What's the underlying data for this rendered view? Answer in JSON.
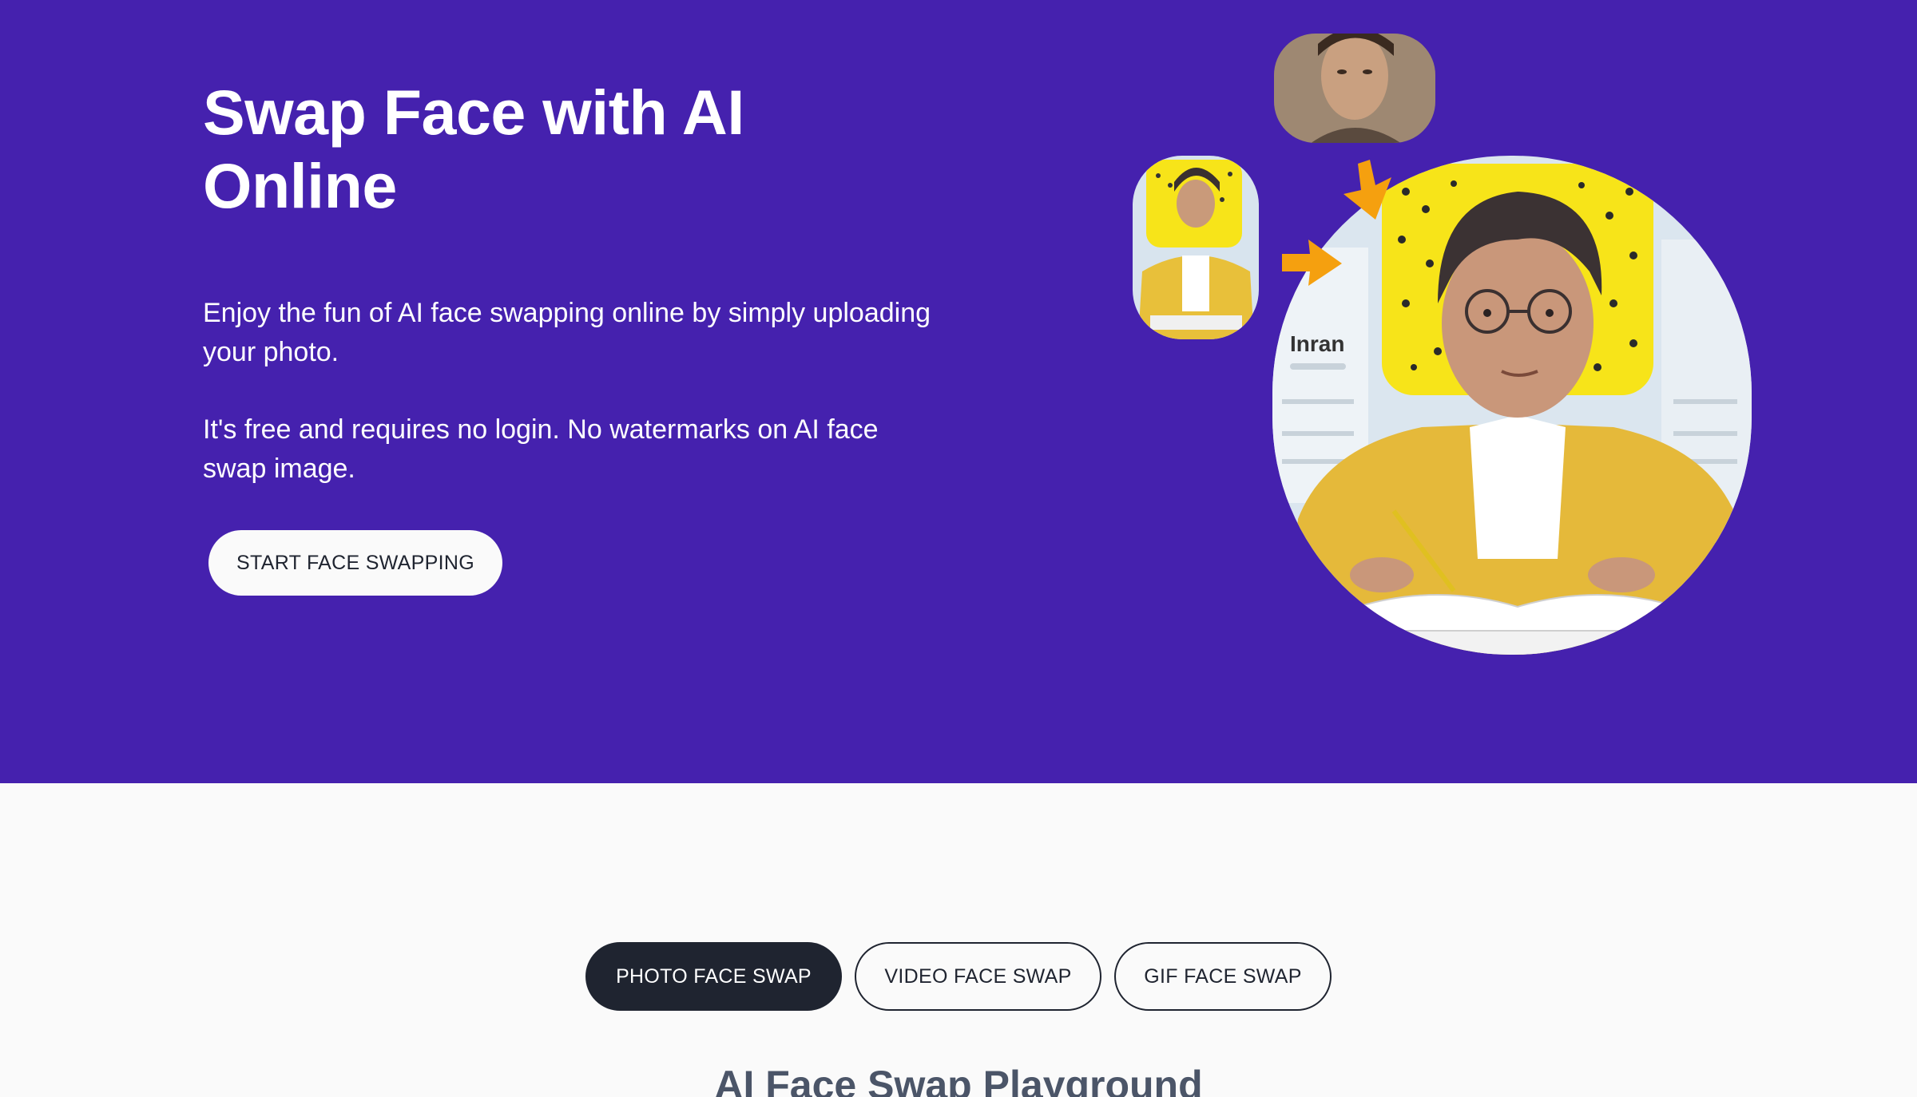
{
  "hero": {
    "title": "Swap Face with AI Online",
    "paragraph_1": "Enjoy the fun of AI face swapping online by simply uploading your photo.",
    "paragraph_2": "It's free and requires no login. No watermarks on AI face swap image.",
    "cta_label": "START FACE SWAPPING",
    "background_color": "#4521ae",
    "illustration": {
      "main_image_name_text": "Inran"
    }
  },
  "tabs": [
    {
      "label": "PHOTO FACE SWAP",
      "active": true
    },
    {
      "label": "VIDEO FACE SWAP",
      "active": false
    },
    {
      "label": "GIF FACE SWAP",
      "active": false
    }
  ],
  "playground": {
    "title": "AI Face Swap Playground"
  },
  "colors": {
    "accent_purple": "#4521ae",
    "dark": "#1f2430",
    "arrow_orange": "#f5a00f",
    "snap_yellow": "#f7e419"
  }
}
